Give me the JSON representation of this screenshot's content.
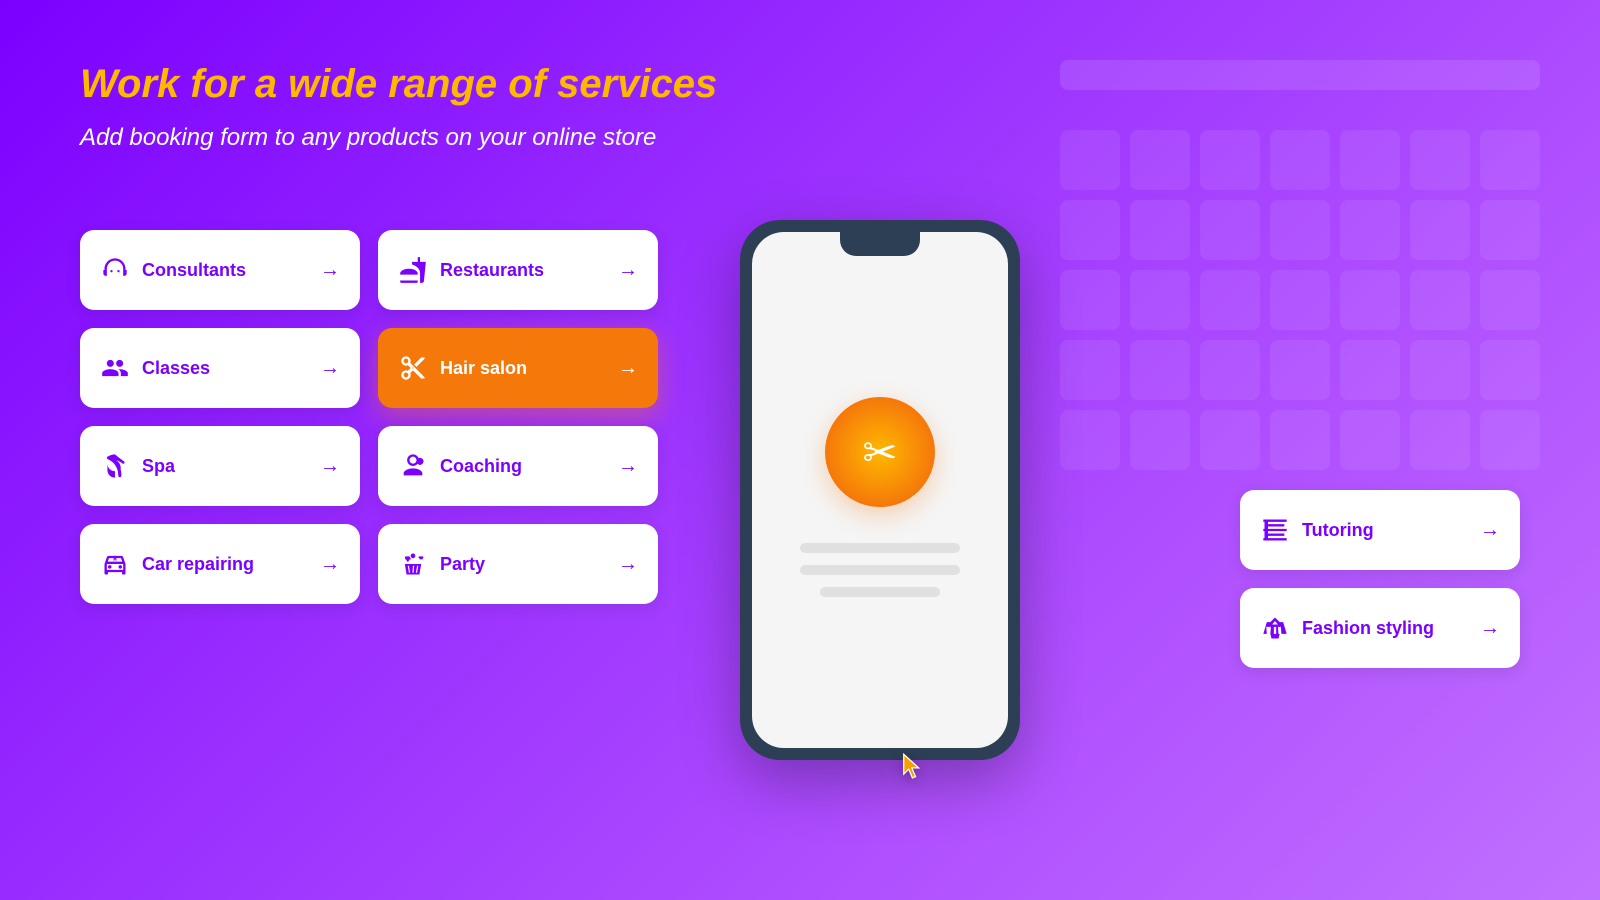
{
  "page": {
    "title": "Work for a wide range of services",
    "subtitle": "Add booking form to any products on your online store"
  },
  "colors": {
    "accent_yellow": "#FFB800",
    "accent_orange": "#F5780A",
    "purple_dark": "#7B00FF",
    "purple_mid": "#9B30FF",
    "white": "#ffffff",
    "bg_start": "#7B00FF",
    "bg_end": "#C070FF"
  },
  "service_cards": [
    {
      "id": "consultants",
      "label": "Consultants",
      "icon": "headset",
      "highlighted": false,
      "col": 1
    },
    {
      "id": "restaurants",
      "label": "Restaurants",
      "icon": "cutlery",
      "highlighted": false,
      "col": 2
    },
    {
      "id": "classes",
      "label": "Classes",
      "icon": "classes",
      "highlighted": false,
      "col": 1
    },
    {
      "id": "hair-salon",
      "label": "Hair salon",
      "icon": "scissors",
      "highlighted": true,
      "col": 2
    },
    {
      "id": "spa",
      "label": "Spa",
      "icon": "spa",
      "highlighted": false,
      "col": 1
    },
    {
      "id": "coaching",
      "label": "Coaching",
      "icon": "coaching",
      "highlighted": false,
      "col": 2
    },
    {
      "id": "car-repairing",
      "label": "Car repairing",
      "icon": "car",
      "highlighted": false,
      "col": 1
    },
    {
      "id": "party",
      "label": "Party",
      "icon": "party",
      "highlighted": false,
      "col": 2
    }
  ],
  "right_cards": [
    {
      "id": "tutoring",
      "label": "Tutoring",
      "icon": "tutoring"
    },
    {
      "id": "fashion-styling",
      "label": "Fashion styling",
      "icon": "fashion"
    }
  ],
  "phone": {
    "icon": "✂️",
    "alt": "Hair salon scissors and comb icon"
  },
  "arrows": {
    "label": "→"
  }
}
